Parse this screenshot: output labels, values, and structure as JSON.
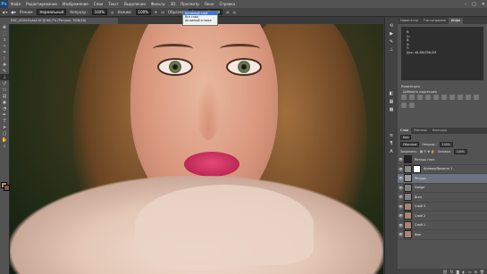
{
  "app": {
    "logo": "Ps"
  },
  "menu": [
    "Файл",
    "Редактирование",
    "Изображение",
    "Слои",
    "Текст",
    "Выделение",
    "Фильтр",
    "3D",
    "Просмотр",
    "Окно",
    "Справка"
  ],
  "window_controls": {
    "minimize": "–",
    "maximize": "□",
    "close": "✕"
  },
  "options": {
    "mode_label": "Режим:",
    "mode_value": "Нормальный",
    "opacity_label": "Непрозр.:",
    "opacity_value": "100%",
    "flow_label": "Нажим:",
    "flow_value": "100%",
    "sample_label": "Образец:",
    "sample_value": "Активный слой"
  },
  "sample_dropdown": {
    "items": [
      "Активный слой",
      "Все слои",
      "Активный и ниже"
    ],
    "selected_index": 0
  },
  "document": {
    "tab_title": "DSC_0004-Eyes4.tif @ 66,7% (Ретушь, RGB/16)"
  },
  "right_panel": {
    "top_tabs": [
      "Навигатор",
      "Гистограмма",
      "Инфо"
    ],
    "info_rows": [
      "R:",
      "G:",
      "B:",
      "X:",
      "Y:",
      "Док: 48,6M/256,0M"
    ],
    "adjustments_title": "Коррекция",
    "adj_add_label": "Добавить коррекцию"
  },
  "layers_panel": {
    "tabs": [
      "Слои",
      "Каналы",
      "Контуры"
    ],
    "kind_label": "Вид",
    "blend_mode": "Обычные",
    "opacity_label": "Непрозр.:",
    "opacity_value": "100%",
    "lock_label": "Закрепить:",
    "fill_label": "Заливка:",
    "fill_value": "100%",
    "layers": [
      {
        "name": "Ретушь глаз",
        "selected": false
      },
      {
        "name": "Кривые/Яркость 1",
        "selected": false
      },
      {
        "name": "Ретушь",
        "selected": true
      },
      {
        "name": "Dodge",
        "selected": false
      },
      {
        "name": "Burn",
        "selected": false
      },
      {
        "name": "Слой 3",
        "selected": false
      },
      {
        "name": "Слой 2",
        "selected": false
      },
      {
        "name": "Слой 1",
        "selected": false
      },
      {
        "name": "Фон",
        "selected": false
      }
    ]
  }
}
